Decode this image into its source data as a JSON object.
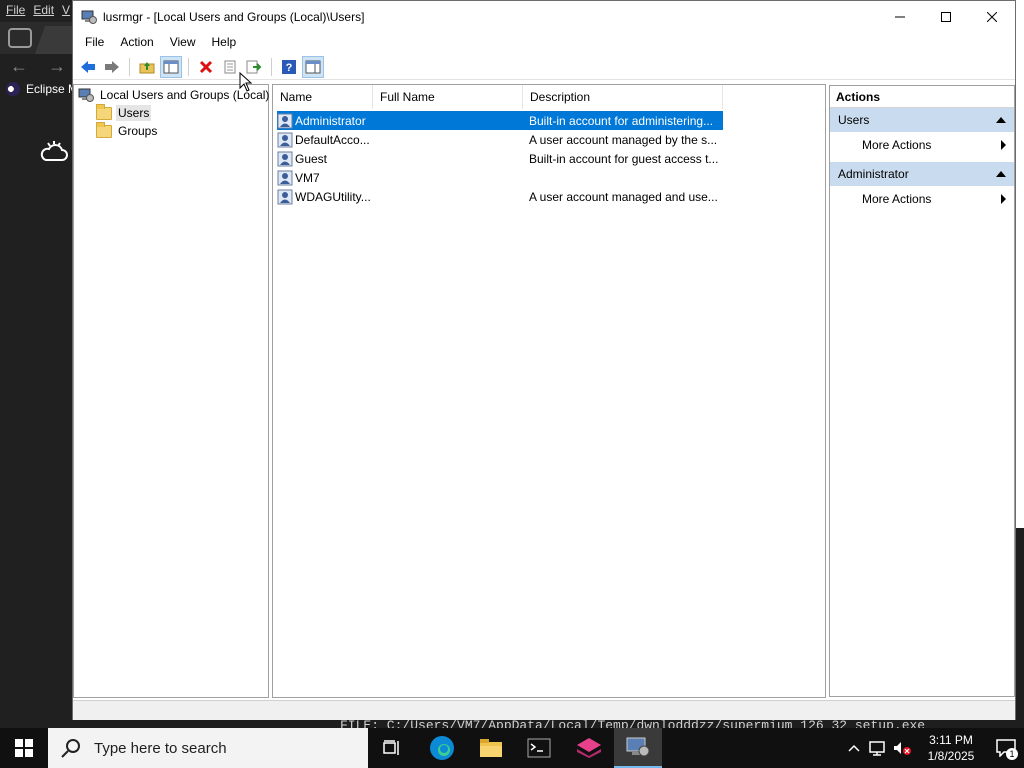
{
  "background_app": {
    "menu": [
      "File",
      "Edit",
      "V"
    ],
    "eclipse_label": "Eclipse M"
  },
  "background_terminal": {
    "line": "FILE: C:/Users/VM7/AppData/Local/Temp/dwnlodddzz/supermium_126_32_setup.exe"
  },
  "window": {
    "title": "lusrmgr - [Local Users and Groups (Local)\\Users]",
    "menu": [
      "File",
      "Action",
      "View",
      "Help"
    ]
  },
  "toolbar": {
    "icons": [
      "back-arrow-icon",
      "forward-arrow-icon",
      "up-folder-icon",
      "show-hide-tree-icon",
      "delete-icon",
      "properties-icon",
      "export-list-icon",
      "help-icon",
      "show-hide-action-pane-icon"
    ]
  },
  "tree": {
    "root": "Local Users and Groups (Local)",
    "children": [
      "Users",
      "Groups"
    ],
    "selected": "Users"
  },
  "list": {
    "columns": [
      "Name",
      "Full Name",
      "Description"
    ],
    "rows": [
      {
        "name": "Administrator",
        "full_name": "",
        "description": "Built-in account for administering..."
      },
      {
        "name": "DefaultAcco...",
        "full_name": "",
        "description": "A user account managed by the s..."
      },
      {
        "name": "Guest",
        "full_name": "",
        "description": "Built-in account for guest access t..."
      },
      {
        "name": "VM7",
        "full_name": "",
        "description": ""
      },
      {
        "name": "WDAGUtility...",
        "full_name": "",
        "description": "A user account managed and use..."
      }
    ],
    "selected_row": "Administrator"
  },
  "actions": {
    "header": "Actions",
    "sections": [
      {
        "title": "Users",
        "items": [
          "More Actions"
        ]
      },
      {
        "title": "Administrator",
        "items": [
          "More Actions"
        ]
      }
    ]
  },
  "taskbar": {
    "search_placeholder": "Type here to search",
    "apps": [
      "task-view-icon",
      "edge-icon",
      "file-explorer-icon",
      "terminal-icon",
      "eclipse-app-icon",
      "lusrmgr-app-icon"
    ],
    "time": "3:11 PM",
    "date": "1/8/2025",
    "notification_count": "1"
  },
  "colors": {
    "selection": "#0078d7",
    "action_section_bg": "#c9dcef",
    "taskbar_bg": "#101010"
  }
}
